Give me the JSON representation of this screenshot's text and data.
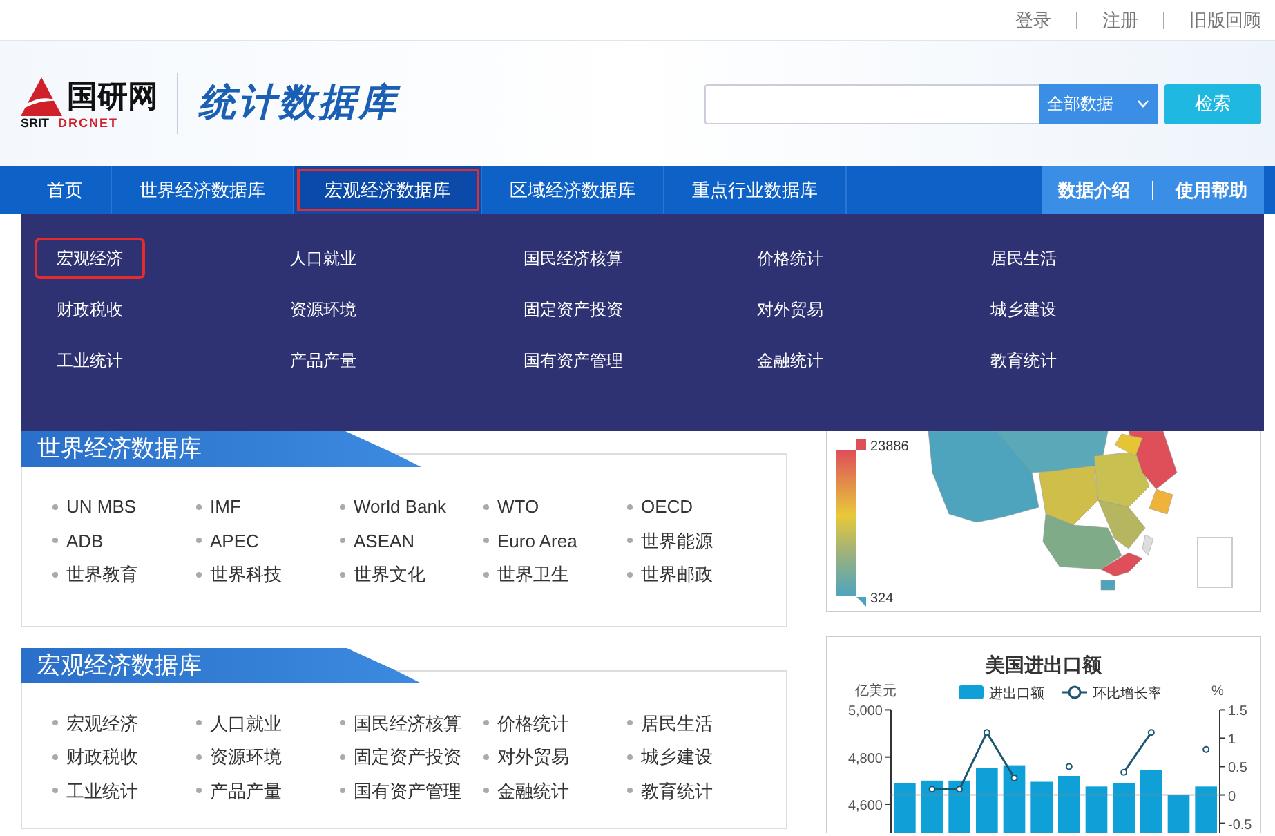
{
  "top_links": [
    {
      "label": "登录"
    },
    {
      "label": "注册"
    },
    {
      "label": "旧版回顾"
    }
  ],
  "logo": {
    "brand": "国研网",
    "left_mark": "SRIT",
    "right_mark": "DRCNET",
    "title": "统计数据库"
  },
  "search": {
    "scope": "全部数据",
    "button": "检索"
  },
  "nav": {
    "items": [
      {
        "label": "首页",
        "selected": false
      },
      {
        "label": "世界经济数据库",
        "selected": false
      },
      {
        "label": "宏观经济数据库",
        "selected": true
      },
      {
        "label": "区域经济数据库",
        "selected": false
      },
      {
        "label": "重点行业数据库",
        "selected": false
      }
    ],
    "right_links": [
      {
        "label": "数据介绍"
      },
      {
        "label": "使用帮助"
      }
    ]
  },
  "dropdown": {
    "items": [
      {
        "label": "宏观经济",
        "selected": true
      },
      {
        "label": "人口就业",
        "selected": false
      },
      {
        "label": "国民经济核算",
        "selected": false
      },
      {
        "label": "价格统计",
        "selected": false
      },
      {
        "label": "居民生活",
        "selected": false
      },
      {
        "label": "财政税收",
        "selected": false
      },
      {
        "label": "资源环境",
        "selected": false
      },
      {
        "label": "固定资产投资",
        "selected": false
      },
      {
        "label": "对外贸易",
        "selected": false
      },
      {
        "label": "城乡建设",
        "selected": false
      },
      {
        "label": "工业统计",
        "selected": false
      },
      {
        "label": "产品产量",
        "selected": false
      },
      {
        "label": "国有资产管理",
        "selected": false
      },
      {
        "label": "金融统计",
        "selected": false
      },
      {
        "label": "教育统计",
        "selected": false
      }
    ]
  },
  "sections": [
    {
      "title": "世界经济数据库",
      "links": [
        "UN MBS",
        "IMF",
        "World Bank",
        "WTO",
        "OECD",
        "ADB",
        "APEC",
        "ASEAN",
        "Euro Area",
        "世界能源",
        "世界教育",
        "世界科技",
        "世界文化",
        "世界卫生",
        "世界邮政"
      ]
    },
    {
      "title": "宏观经济数据库",
      "links": [
        "宏观经济",
        "人口就业",
        "国民经济核算",
        "价格统计",
        "居民生活",
        "财政税收",
        "资源环境",
        "固定资产投资",
        "对外贸易",
        "城乡建设",
        "工业统计",
        "产品产量",
        "国有资产管理",
        "金融统计",
        "教育统计"
      ]
    }
  ],
  "map_panel": {
    "max_label": "23886",
    "min_label": "324"
  },
  "chart_panel": {
    "amount_chart": {
      "chart_data": {
        "type": "bar",
        "title": "美国进出口额",
        "ylabel": "亿美元",
        "ylim": [
          4471,
          5000
        ],
        "yticks": [
          {
            "value": 4600,
            "label": "4,600"
          },
          {
            "value": 4800,
            "label": "4,800"
          },
          {
            "value": 5000,
            "label": "5,000"
          }
        ],
        "series": [
          {
            "name": "进出口额",
            "color": "#0fa0d8",
            "values": [
              4690,
              4700,
              4700,
              4755,
              4765,
              4695,
              4720,
              4675,
              4690,
              4745,
              4640,
              4675
            ]
          }
        ]
      }
    },
    "rate_chart": {
      "chart_data": {
        "type": "line",
        "ylabel": "%",
        "ylim": [
          -0.7,
          1.5
        ],
        "yticks": [
          -0.5,
          0,
          0.5,
          1,
          1.5
        ],
        "series": [
          {
            "name": "环比增长率",
            "color": "#1d5670",
            "marker": "circle",
            "values": [
              null,
              0.1,
              0.1,
              1.1,
              0.3,
              null,
              0.5,
              null,
              0.4,
              1.1,
              null,
              0.8
            ]
          }
        ]
      }
    }
  }
}
